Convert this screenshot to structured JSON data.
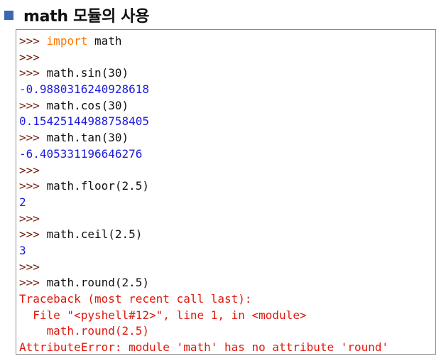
{
  "heading": {
    "title": "math 모듈의 사용"
  },
  "colors": {
    "bullet": "#3f67b1",
    "prompt": "#6e1e0f",
    "keyword": "#ff7700",
    "output": "#1c1cde",
    "error": "#e0180c"
  },
  "shell": {
    "prompt": ">>>",
    "lines": [
      {
        "kind": "input",
        "keyword": "import",
        "code": " math"
      },
      {
        "kind": "input",
        "code": ""
      },
      {
        "kind": "input",
        "code": " math.sin(30)"
      },
      {
        "kind": "output",
        "text": "-0.9880316240928618"
      },
      {
        "kind": "input",
        "code": " math.cos(30)"
      },
      {
        "kind": "output",
        "text": "0.15425144988758405"
      },
      {
        "kind": "input",
        "code": " math.tan(30)"
      },
      {
        "kind": "output",
        "text": "-6.405331196646276"
      },
      {
        "kind": "input",
        "code": ""
      },
      {
        "kind": "input",
        "code": " math.floor(2.5)"
      },
      {
        "kind": "output",
        "text": "2"
      },
      {
        "kind": "input",
        "code": ""
      },
      {
        "kind": "input",
        "code": " math.ceil(2.5)"
      },
      {
        "kind": "output",
        "text": "3"
      },
      {
        "kind": "input",
        "code": ""
      },
      {
        "kind": "input",
        "code": " math.round(2.5)"
      },
      {
        "kind": "error",
        "text": "Traceback (most recent call last):"
      },
      {
        "kind": "error",
        "text": "  File \"<pyshell#12>\", line 1, in <module>"
      },
      {
        "kind": "error",
        "text": "    math.round(2.5)"
      },
      {
        "kind": "error",
        "text": "AttributeError: module 'math' has no attribute 'round'"
      }
    ]
  }
}
